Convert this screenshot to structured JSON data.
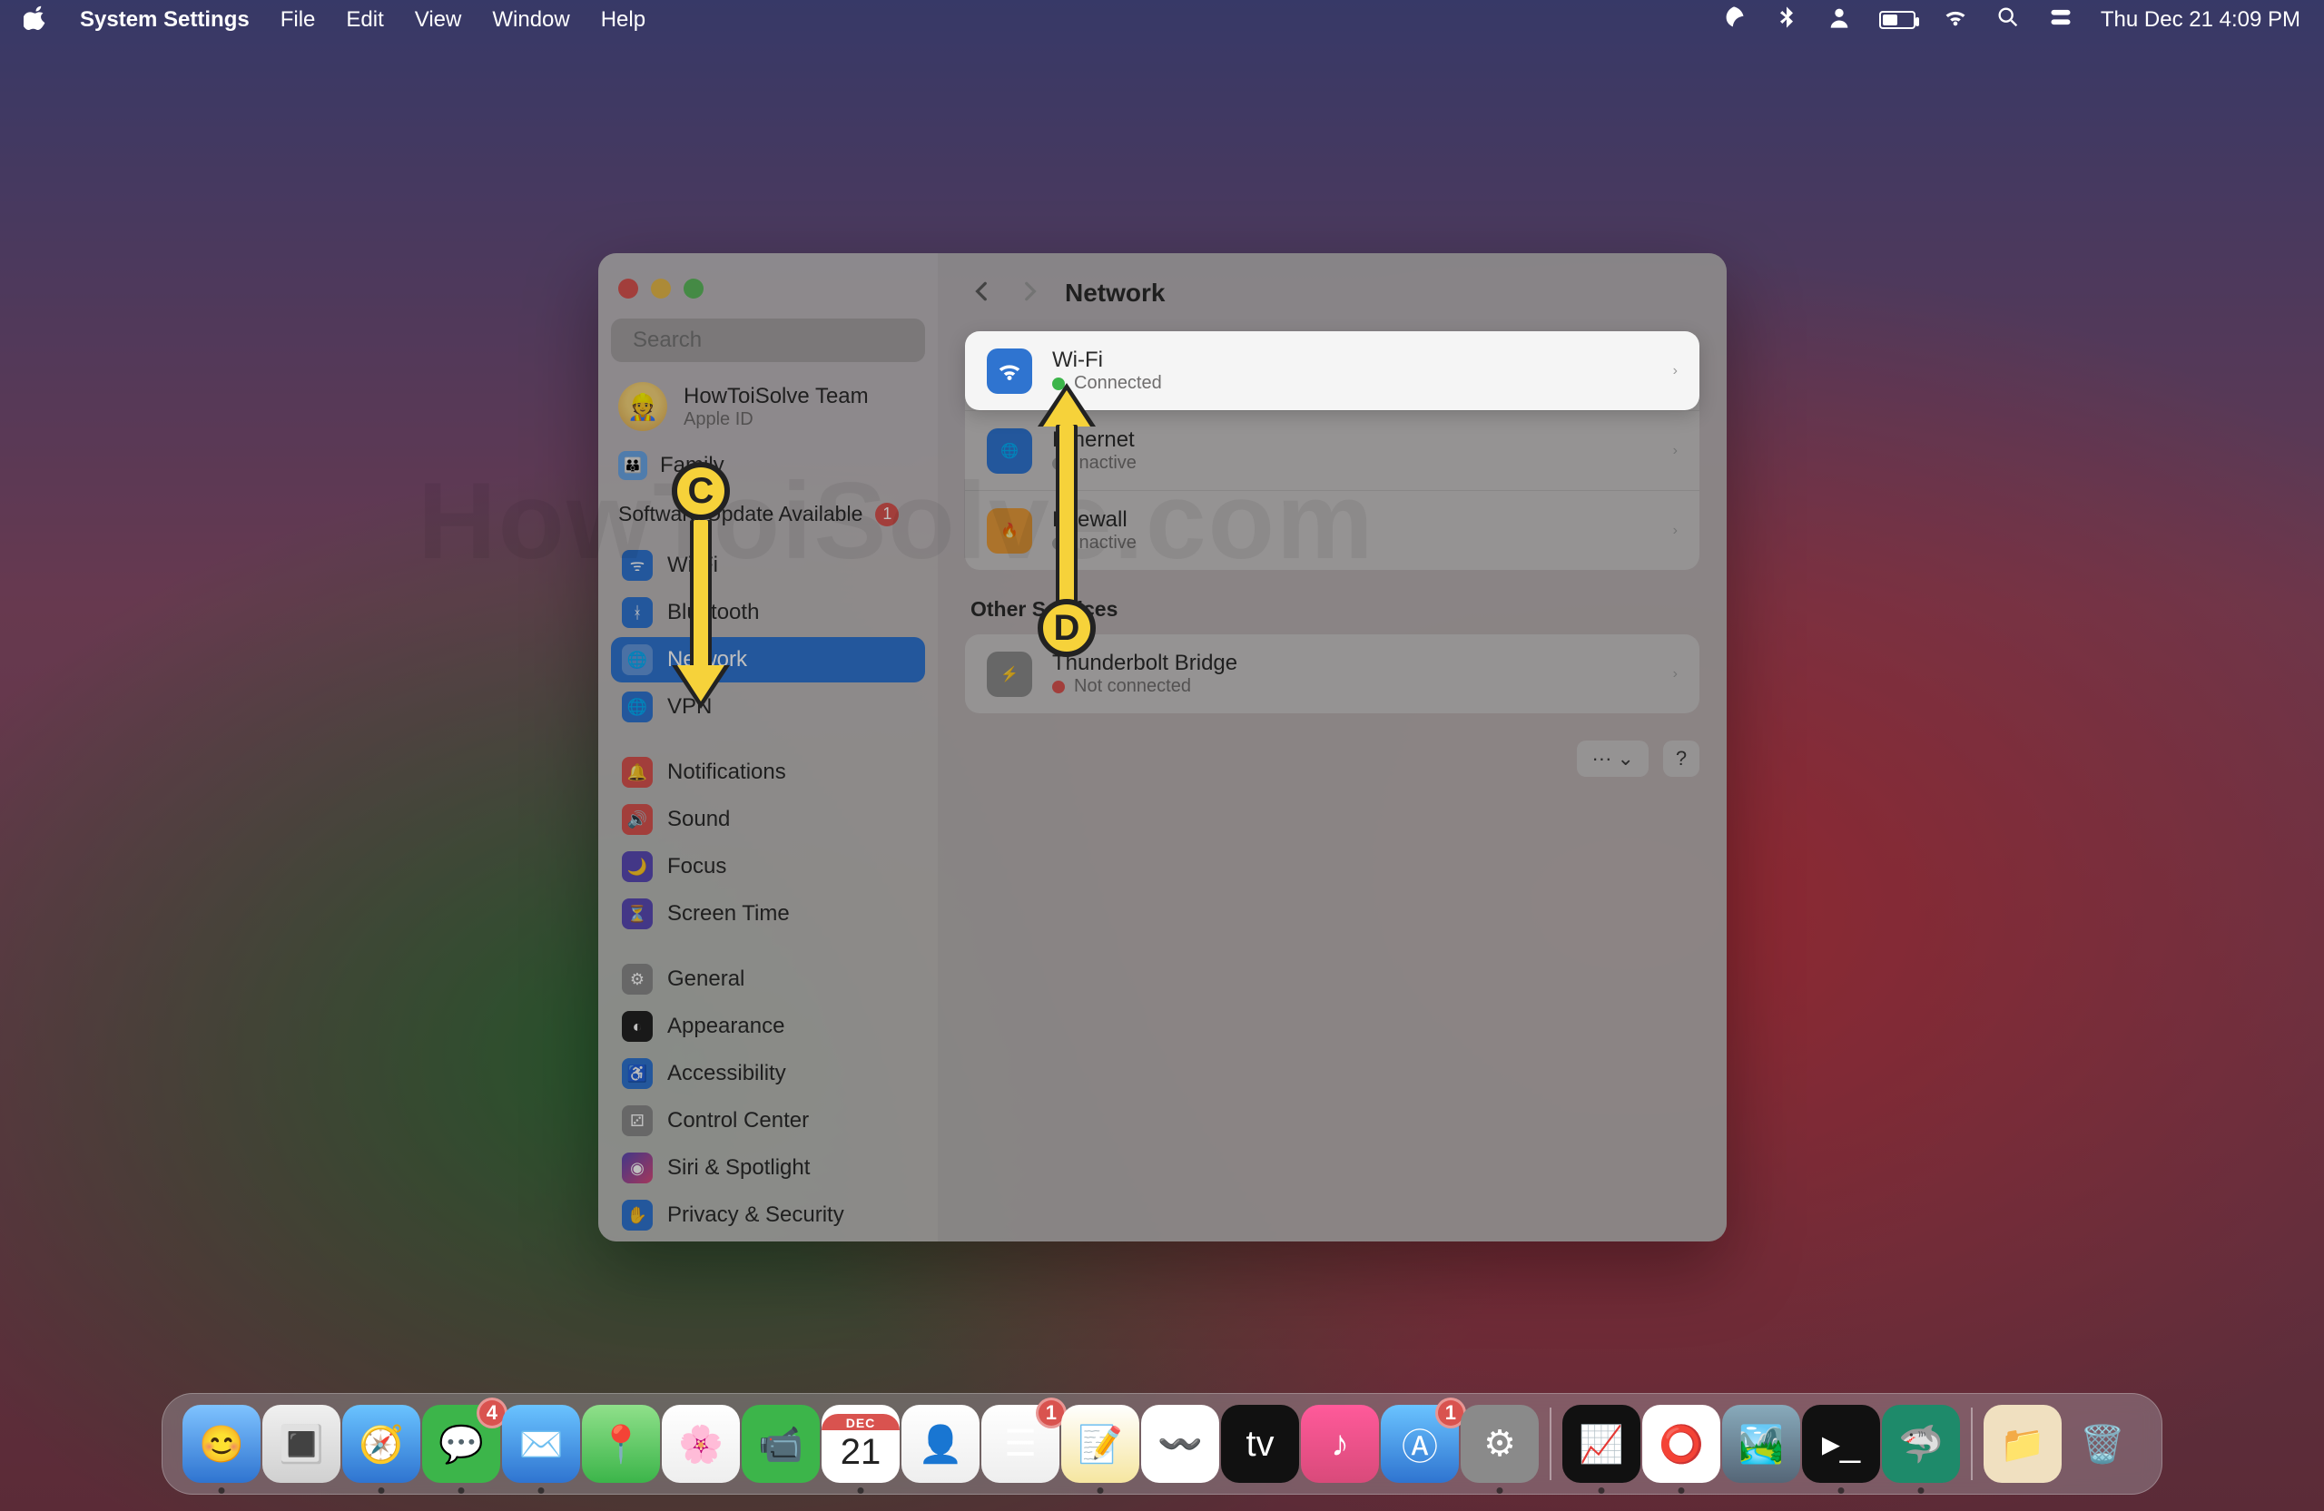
{
  "menubar": {
    "app_name": "System Settings",
    "items": [
      "File",
      "Edit",
      "View",
      "Window",
      "Help"
    ],
    "clock": "Thu Dec 21  4:09 PM"
  },
  "window": {
    "search_placeholder": "Search",
    "account": {
      "name": "HowToiSolve Team",
      "sub": "Apple ID"
    },
    "family_label": "Family",
    "software_update": {
      "label": "Software Update Available",
      "badge": "1"
    },
    "nav": {
      "group1": [
        {
          "label": "Wi-Fi",
          "icon": "wifi"
        },
        {
          "label": "Bluetooth",
          "icon": "bt"
        },
        {
          "label": "Network",
          "icon": "net",
          "selected": true
        },
        {
          "label": "VPN",
          "icon": "vpn"
        }
      ],
      "group2": [
        {
          "label": "Notifications",
          "icon": "notif"
        },
        {
          "label": "Sound",
          "icon": "sound"
        },
        {
          "label": "Focus",
          "icon": "focus"
        },
        {
          "label": "Screen Time",
          "icon": "st"
        }
      ],
      "group3": [
        {
          "label": "General",
          "icon": "gen"
        },
        {
          "label": "Appearance",
          "icon": "app"
        },
        {
          "label": "Accessibility",
          "icon": "acc"
        },
        {
          "label": "Control Center",
          "icon": "cc"
        },
        {
          "label": "Siri & Spotlight",
          "icon": "siri"
        },
        {
          "label": "Privacy & Security",
          "icon": "priv"
        }
      ]
    },
    "main": {
      "title": "Network",
      "services": [
        {
          "title": "Wi-Fi",
          "status": "Connected",
          "dot": "green",
          "icon_bg": "#2f74d0",
          "highlight": true
        },
        {
          "title": "Ethernet",
          "status": "Inactive",
          "dot": "gray",
          "icon_bg": "#2f74d0"
        },
        {
          "title": "Firewall",
          "status": "Inactive",
          "dot": "gray",
          "icon_bg": "#e69a3a"
        }
      ],
      "other_label": "Other Services",
      "others": [
        {
          "title": "Thunderbolt Bridge",
          "status": "Not connected",
          "dot": "red",
          "icon_bg": "#8a8a8a"
        }
      ],
      "more_symbol": "···  ⌄",
      "help_symbol": "?"
    }
  },
  "annotations": {
    "c": "C",
    "d": "D"
  },
  "watermark": "HowToiSolve.com",
  "dock": {
    "calendar": {
      "month": "DEC",
      "day": "21"
    },
    "badges": {
      "messages": "4",
      "reminders": "1",
      "appstore": "1"
    }
  }
}
